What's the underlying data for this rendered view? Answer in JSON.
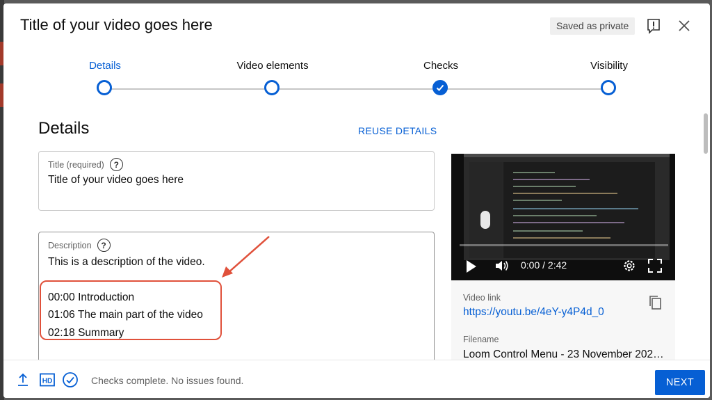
{
  "dialog": {
    "title": "Title of your video goes here",
    "saved_badge": "Saved as private"
  },
  "stepper": {
    "steps": [
      {
        "label": "Details",
        "state": "active"
      },
      {
        "label": "Video elements",
        "state": "pending"
      },
      {
        "label": "Checks",
        "state": "done"
      },
      {
        "label": "Visibility",
        "state": "pending"
      }
    ]
  },
  "details": {
    "heading": "Details",
    "reuse_label": "REUSE DETAILS",
    "title_field": {
      "label": "Title (required)",
      "value": "Title of your video goes here"
    },
    "description_field": {
      "label": "Description",
      "lines": [
        "This is a description of the video.",
        "",
        "00:00 Introduction",
        "01:06 The main part of the video",
        "02:18 Summary"
      ]
    }
  },
  "preview": {
    "time": "0:00 / 2:42",
    "video_link_label": "Video link",
    "video_link": "https://youtu.be/4eY-y4P4d_0",
    "filename_label": "Filename",
    "filename": "Loom Control Menu - 23 November 202…"
  },
  "footer": {
    "status": "Checks complete. No issues found.",
    "next_label": "NEXT"
  },
  "colors": {
    "accent": "#065fd4",
    "annotation": "#e0513b"
  },
  "icons": [
    "flag-icon",
    "close-icon",
    "help-icon",
    "check-icon",
    "play-icon",
    "volume-icon",
    "settings-icon",
    "fullscreen-icon",
    "copy-icon",
    "upload-icon",
    "hd-icon",
    "check-circle-icon"
  ]
}
